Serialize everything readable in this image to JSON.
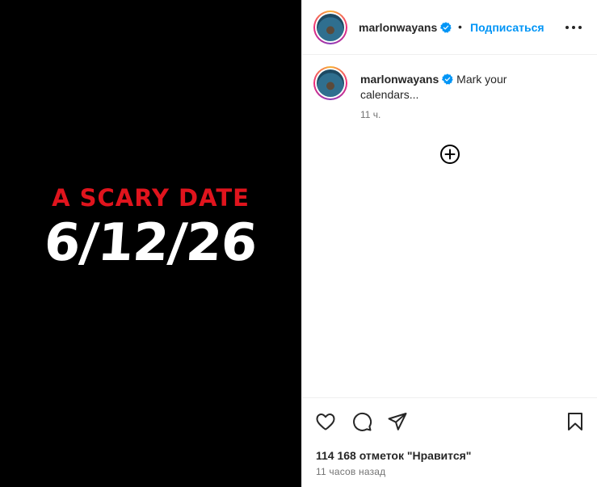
{
  "media": {
    "title": "A SCARY DATE",
    "date": "6/12/26"
  },
  "header": {
    "username": "marlonwayans",
    "separator": "•",
    "follow_label": "Подписаться"
  },
  "caption": {
    "username": "marlonwayans",
    "text": "Mark your calendars...",
    "time": "11 ч."
  },
  "footer": {
    "likes": "114 168 отметок \"Нравится\"",
    "posted": "11 часов назад"
  },
  "colors": {
    "accent": "#0095f6",
    "verified": "#0095f6",
    "title_red": "#e0141d"
  },
  "icons": [
    "verified-badge-icon",
    "more-options-icon",
    "add-comment-icon",
    "heart-icon",
    "comment-icon",
    "share-icon",
    "bookmark-icon"
  ]
}
